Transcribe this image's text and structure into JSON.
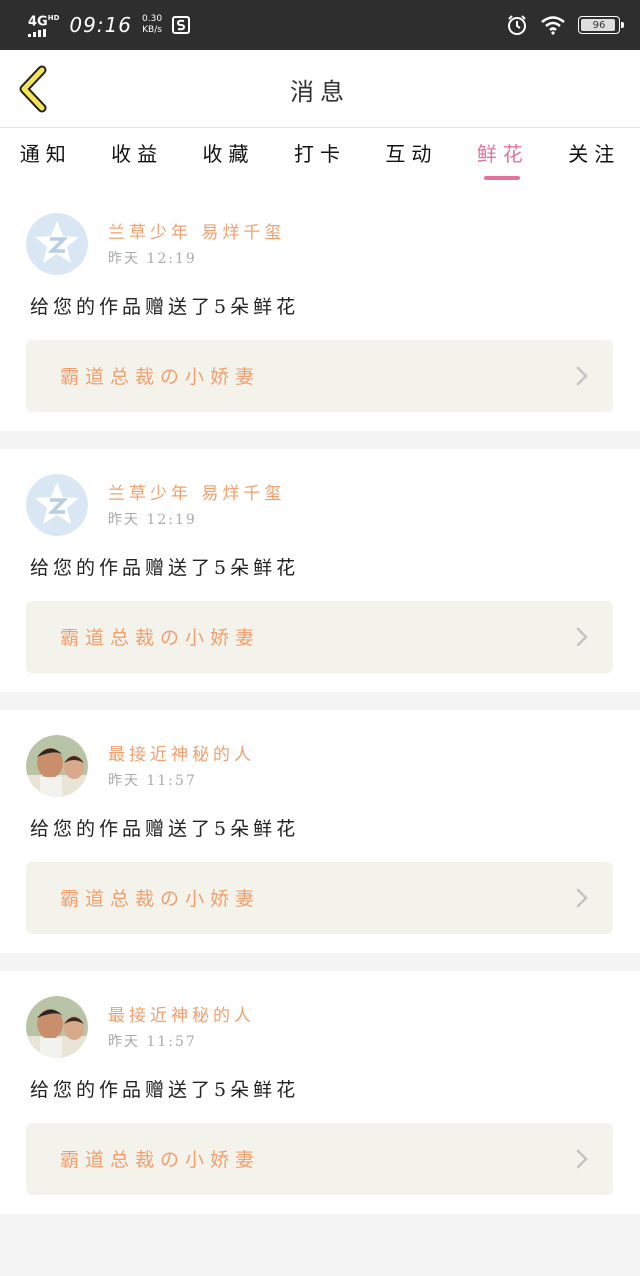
{
  "status_bar": {
    "network": "4G",
    "network_sup": "HD",
    "time": "09:16",
    "speed_value": "0.30",
    "speed_unit": "KB/s",
    "battery": "96",
    "icons": [
      "signal-icon",
      "app-notification-icon",
      "alarm-icon",
      "wifi-icon",
      "battery-icon"
    ]
  },
  "header": {
    "title": "消息",
    "back_icon": "chevron-left-icon"
  },
  "tabs": [
    {
      "label": "通知",
      "active": false
    },
    {
      "label": "收益",
      "active": false
    },
    {
      "label": "收藏",
      "active": false
    },
    {
      "label": "打卡",
      "active": false
    },
    {
      "label": "互动",
      "active": false
    },
    {
      "label": "鲜花",
      "active": true
    },
    {
      "label": "关注",
      "active": false
    }
  ],
  "colors": {
    "accent": "#e2739c",
    "name": "#f0a06e",
    "work_box": "#f3f3ec"
  },
  "messages": [
    {
      "avatar": "qq-default-avatar",
      "name": "兰草少年 易烊千玺",
      "time": "昨天 12:19",
      "text": "给您的作品赠送了5朵鲜花",
      "work": "霸道总裁の小娇妻"
    },
    {
      "avatar": "qq-default-avatar",
      "name": "兰草少年 易烊千玺",
      "time": "昨天 12:19",
      "text": "给您的作品赠送了5朵鲜花",
      "work": "霸道总裁の小娇妻"
    },
    {
      "avatar": "photo-avatar",
      "name": "最接近神秘的人",
      "time": "昨天 11:57",
      "text": "给您的作品赠送了5朵鲜花",
      "work": "霸道总裁の小娇妻"
    },
    {
      "avatar": "photo-avatar",
      "name": "最接近神秘的人",
      "time": "昨天 11:57",
      "text": "给您的作品赠送了5朵鲜花",
      "work": "霸道总裁の小娇妻"
    }
  ]
}
